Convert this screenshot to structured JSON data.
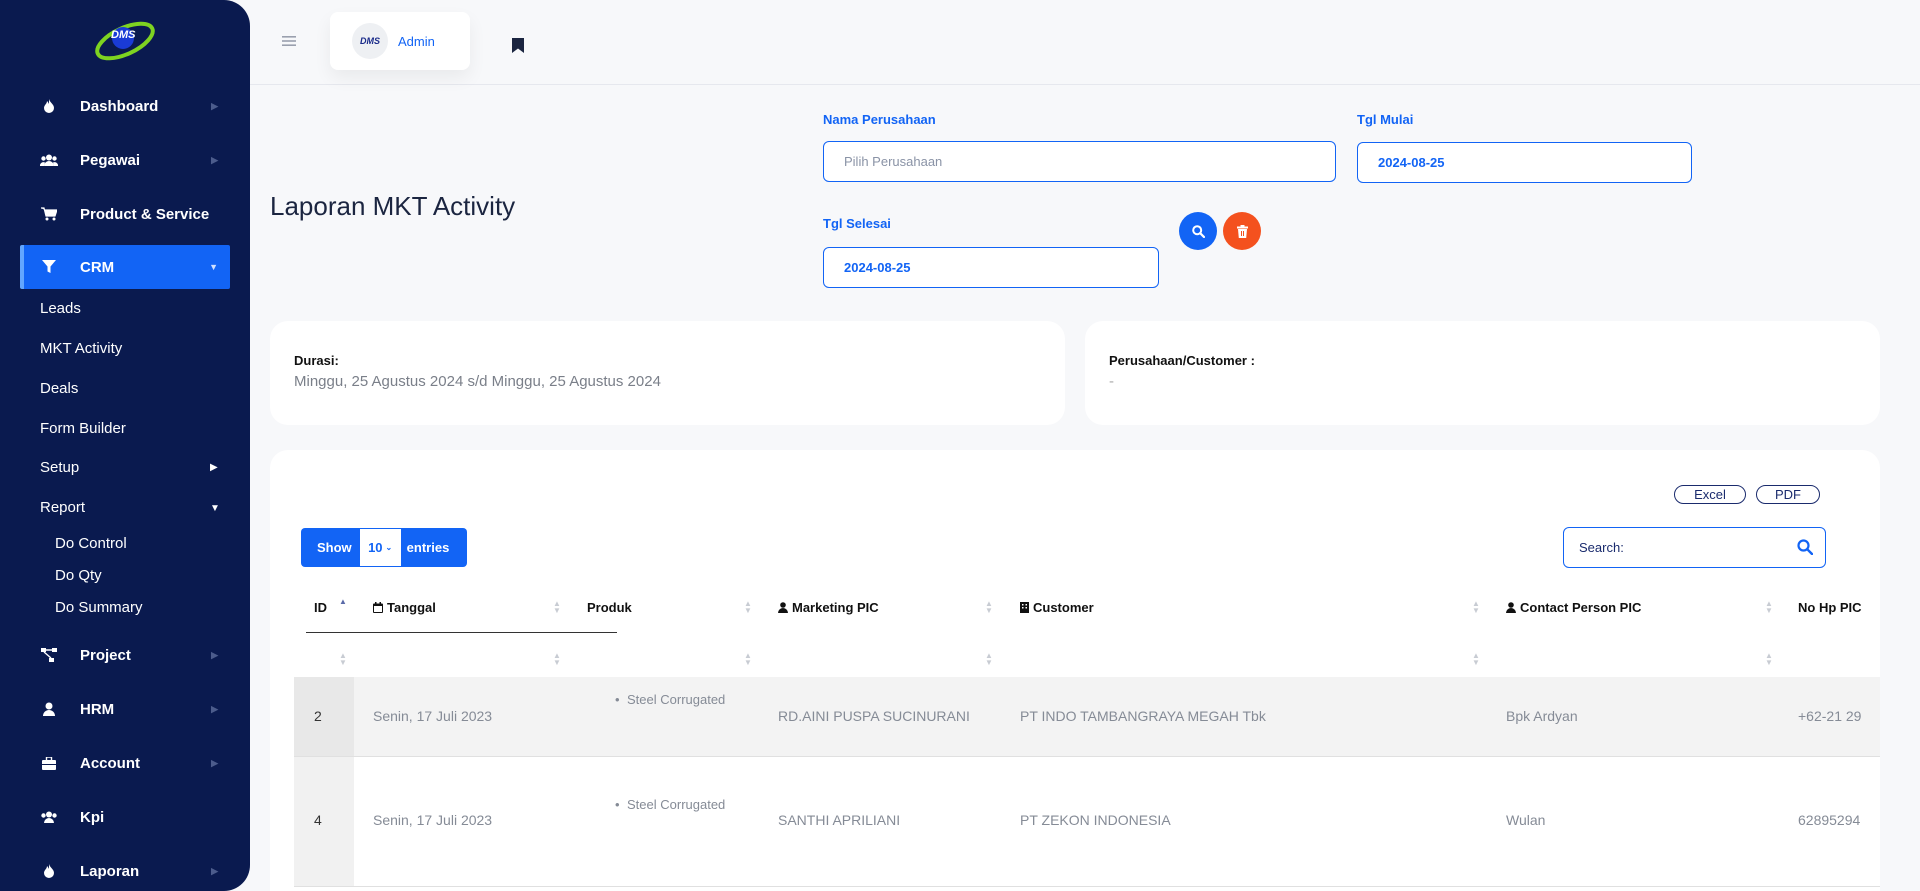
{
  "sidebar": {
    "items": [
      {
        "label": "Dashboard"
      },
      {
        "label": "Pegawai"
      },
      {
        "label": "Product & Service"
      },
      {
        "label": "CRM"
      },
      {
        "label": "Project"
      },
      {
        "label": "HRM"
      },
      {
        "label": "Account"
      },
      {
        "label": "Kpi"
      },
      {
        "label": "Laporan"
      }
    ],
    "crm_sub": [
      "Leads",
      "MKT Activity",
      "Deals",
      "Form Builder",
      "Setup",
      "Report"
    ],
    "report_sub": [
      "Do Control",
      "Do Qty",
      "Do Summary"
    ],
    "logo_text": "DMS"
  },
  "topbar": {
    "user_name": "Admin"
  },
  "page": {
    "title": "Laporan MKT Activity"
  },
  "filters": {
    "company_label": "Nama Perusahaan",
    "company_placeholder": "Pilih Perusahaan",
    "start_label": "Tgl Mulai",
    "start_value": "2024-08-25",
    "end_label": "Tgl Selesai",
    "end_value": "2024-08-25"
  },
  "info": {
    "duration_label": "Durasi:",
    "duration_value": "Minggu, 25 Agustus 2024 s/d Minggu, 25 Agustus 2024",
    "customer_label": "Perusahaan/Customer :",
    "customer_value": "-"
  },
  "table": {
    "export_excel": "Excel",
    "export_pdf": "PDF",
    "show_label": "Show",
    "length_value": "10",
    "entries_label": "entries",
    "search_label": "Search:",
    "columns": [
      "ID",
      "Tanggal",
      "Produk",
      "Marketing PIC",
      "Customer",
      "Contact Person PIC",
      "No Hp PIC"
    ],
    "rows": [
      {
        "id": "2",
        "tanggal": "Senin, 17 Juli 2023",
        "produk": "Steel Corrugated",
        "marketing": "RD.AINI PUSPA SUCINURANI",
        "customer": "PT INDO TAMBANGRAYA MEGAH Tbk",
        "contact": "Bpk Ardyan",
        "hp": "+62-21 29"
      },
      {
        "id": "4",
        "tanggal": "Senin, 17 Juli 2023",
        "produk": "Steel Corrugated",
        "marketing": "SANTHI APRILIANI",
        "customer": "PT ZEKON INDONESIA",
        "contact": "Wulan",
        "hp": "62895294"
      }
    ]
  },
  "colors": {
    "sidebar_bg": "#0a1a4f",
    "accent": "#1264f5",
    "delete": "#f4511e"
  }
}
